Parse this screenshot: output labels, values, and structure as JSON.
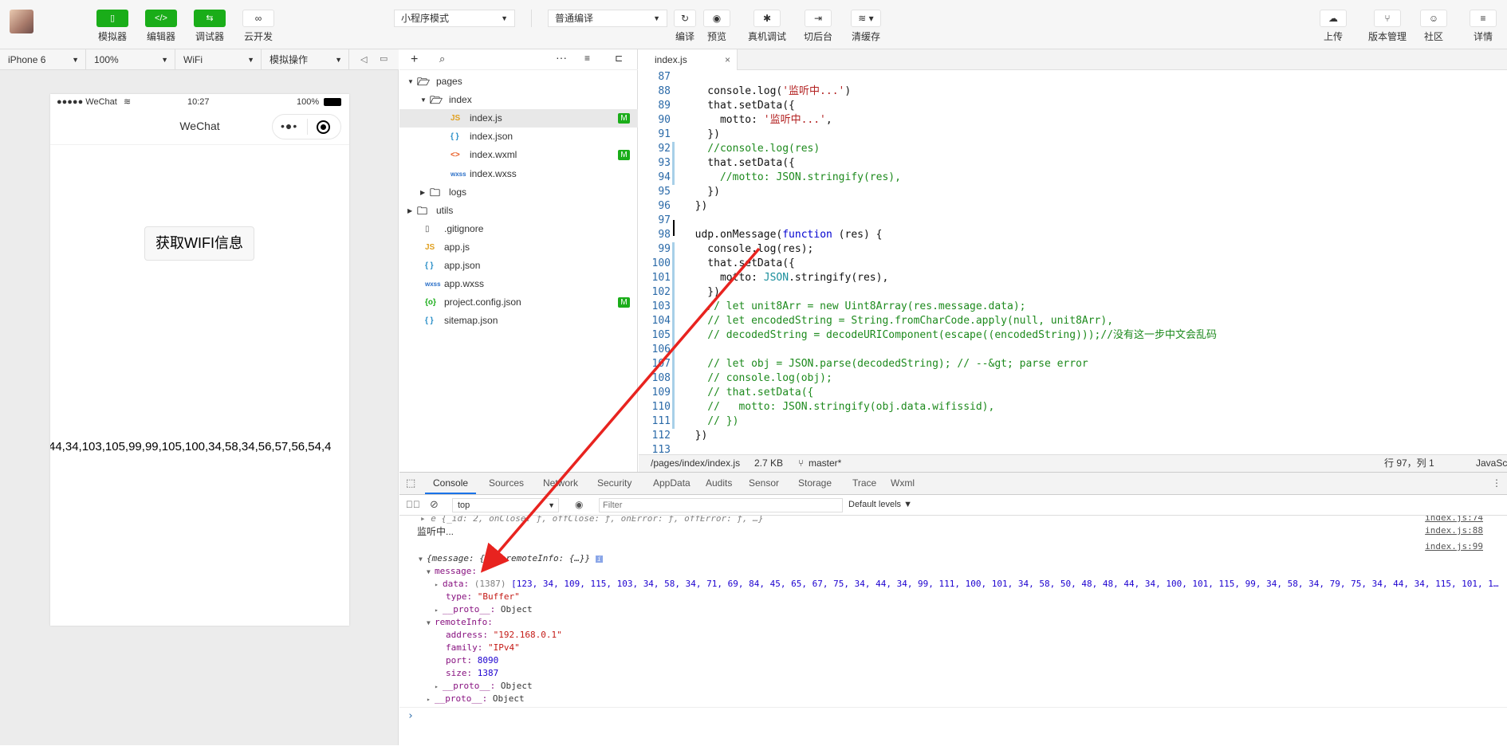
{
  "toolbar": {
    "buttons_left": [
      {
        "label": "模拟器",
        "icon": "phone-icon"
      },
      {
        "label": "编辑器",
        "icon": "code-icon"
      },
      {
        "label": "调试器",
        "icon": "debug-arrows-icon"
      },
      {
        "label": "云开发",
        "icon": "cloud-link-icon"
      }
    ],
    "mode_select": "小程序模式",
    "compile_select": "普通编译",
    "buttons_mid": [
      {
        "label": "编译",
        "icon": "refresh-icon"
      },
      {
        "label": "预览",
        "icon": "eye-icon"
      },
      {
        "label": "真机调试",
        "icon": "bug-icon"
      },
      {
        "label": "切后台",
        "icon": "switch-icon"
      },
      {
        "label": "清缓存",
        "icon": "layers-icon"
      }
    ],
    "buttons_right": [
      {
        "label": "上传",
        "icon": "upload-icon"
      },
      {
        "label": "版本管理",
        "icon": "branch-icon"
      },
      {
        "label": "社区",
        "icon": "chat-icon"
      },
      {
        "label": "详情",
        "icon": "menu-icon"
      }
    ]
  },
  "devbar": {
    "device": "iPhone 6",
    "zoom": "100%",
    "network": "WiFi",
    "ops": "模拟操作"
  },
  "phone": {
    "carrier": "●●●●● WeChat",
    "time": "10:27",
    "battery": "100%",
    "nav_title": "WeChat",
    "button_label": "获取WIFI信息",
    "data_text": "44,34,103,105,99,99,105,100,34,58,34,56,57,56,54,4"
  },
  "explorer": {
    "items": [
      {
        "label": "pages",
        "type": "folder-open",
        "depth": 0,
        "arrow": "▼"
      },
      {
        "label": "index",
        "type": "folder-open",
        "depth": 1,
        "arrow": "▼"
      },
      {
        "label": "index.js",
        "type": "js",
        "depth": 2,
        "badge": "M",
        "active": true
      },
      {
        "label": "index.json",
        "type": "json",
        "depth": 2
      },
      {
        "label": "index.wxml",
        "type": "wxml",
        "depth": 2,
        "badge": "M"
      },
      {
        "label": "index.wxss",
        "type": "wxss",
        "depth": 2
      },
      {
        "label": "logs",
        "type": "folder",
        "depth": 1,
        "arrow": "▶"
      },
      {
        "label": "utils",
        "type": "folder",
        "depth": 0,
        "arrow": "▶"
      },
      {
        "label": ".gitignore",
        "type": "file",
        "depth": 0
      },
      {
        "label": "app.js",
        "type": "js",
        "depth": 0
      },
      {
        "label": "app.json",
        "type": "json",
        "depth": 0
      },
      {
        "label": "app.wxss",
        "type": "wxss",
        "depth": 0
      },
      {
        "label": "project.config.json",
        "type": "config",
        "depth": 0,
        "badge": "M"
      },
      {
        "label": "sitemap.json",
        "type": "json",
        "depth": 0
      }
    ]
  },
  "editor": {
    "tab": "index.js",
    "lines": [
      {
        "n": "87",
        "text": ""
      },
      {
        "n": "88",
        "text": "    console.log('监听中...')"
      },
      {
        "n": "89",
        "text": "    that.setData({"
      },
      {
        "n": "90",
        "text": "      motto: '监听中...',"
      },
      {
        "n": "91",
        "text": "    })"
      },
      {
        "n": "92",
        "text": "    //console.log(res)"
      },
      {
        "n": "93",
        "text": "    that.setData({"
      },
      {
        "n": "94",
        "text": "      //motto: JSON.stringify(res),"
      },
      {
        "n": "95",
        "text": "    })"
      },
      {
        "n": "96",
        "text": "  })"
      },
      {
        "n": "97",
        "text": ""
      },
      {
        "n": "98",
        "text": "  udp.onMessage(function (res) {"
      },
      {
        "n": "99",
        "text": "    console.log(res);"
      },
      {
        "n": "100",
        "text": "    that.setData({"
      },
      {
        "n": "101",
        "text": "      motto: JSON.stringify(res),"
      },
      {
        "n": "102",
        "text": "    })"
      },
      {
        "n": "103",
        "text": "    // let unit8Arr = new Uint8Array(res.message.data);"
      },
      {
        "n": "104",
        "text": "    // let encodedString = String.fromCharCode.apply(null, unit8Arr),"
      },
      {
        "n": "105",
        "text": "    // decodedString = decodeURIComponent(escape((encodedString)));//没有这一步中文会乱码"
      },
      {
        "n": "106",
        "text": ""
      },
      {
        "n": "107",
        "text": "    // let obj = JSON.parse(decodedString); // --&gt; parse error"
      },
      {
        "n": "108",
        "text": "    // console.log(obj);"
      },
      {
        "n": "109",
        "text": "    // that.setData({"
      },
      {
        "n": "110",
        "text": "    //   motto: JSON.stringify(obj.data.wifissid),"
      },
      {
        "n": "111",
        "text": "    // })"
      },
      {
        "n": "112",
        "text": "  })"
      },
      {
        "n": "113",
        "text": ""
      }
    ]
  },
  "statusbar": {
    "path": "/pages/index/index.js",
    "size": "2.7 KB",
    "branch": "master*",
    "position": "行 97，列 1",
    "lang": "JavaSc"
  },
  "devtools": {
    "tabs": [
      "Console",
      "Sources",
      "Network",
      "Security",
      "AppData",
      "Audits",
      "Sensor",
      "Storage",
      "Trace",
      "Wxml"
    ],
    "context": "top",
    "filter_placeholder": "Filter",
    "levels": "Default levels ▼",
    "console": {
      "line1": "e {_id: 2, onClose: ƒ, offClose: ƒ, onError: ƒ, offError: ƒ, …}",
      "line1_src": "index.js:74",
      "line2": "监听中...",
      "line2_src": "index.js:88",
      "line3_src": "index.js:99",
      "obj_head": "{message: {…}, remoteInfo: {…}}",
      "message_key": "message:",
      "data_key": "data:",
      "data_count": "(1387)",
      "data_values": "[123, 34, 109, 115, 103, 34, 58, 34, 71, 69, 84, 45, 65, 67, 75, 34, 44, 34, 99, 111, 100, 101, 34, 58, 50, 48, 48, 44, 34, 100, 101, 115, 99, 34, 58, 34, 79, 75, 34, 44, 34, 115, 101, 1…",
      "type_key": "type:",
      "type_val": "\"Buffer\"",
      "proto_key": "__proto__:",
      "proto_val": "Object",
      "remote_key": "remoteInfo:",
      "address_key": "address:",
      "address_val": "\"192.168.0.1\"",
      "family_key": "family:",
      "family_val": "\"IPv4\"",
      "port_key": "port:",
      "port_val": "8090",
      "size_key": "size:",
      "size_val": "1387",
      "prompt": "›"
    }
  },
  "colors": {
    "brand_green": "#1aad19",
    "arrow_red": "#e8231f"
  }
}
